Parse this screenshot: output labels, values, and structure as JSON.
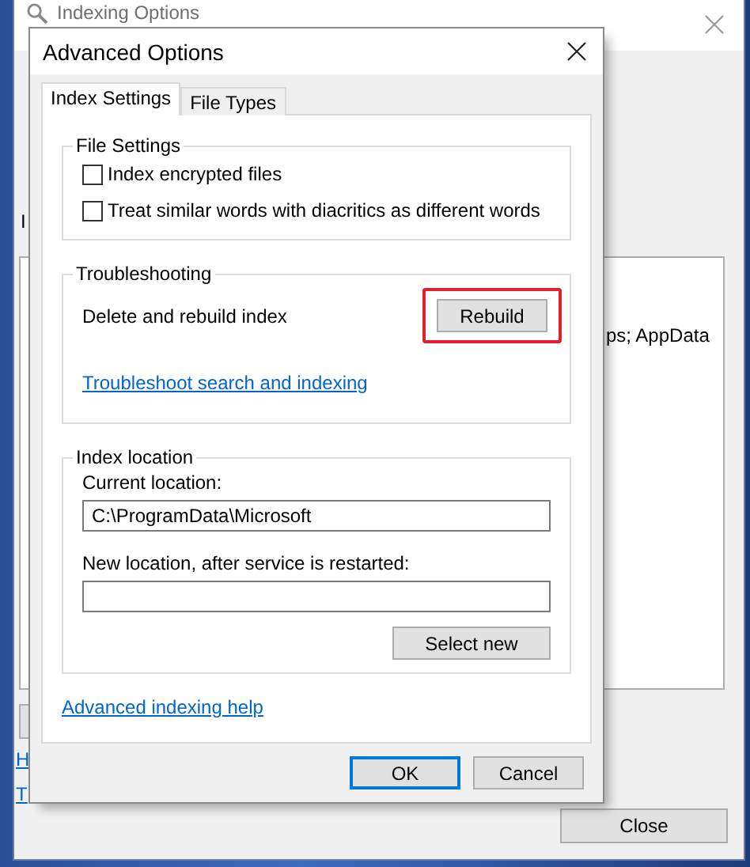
{
  "background_window": {
    "title": "Indexing Options",
    "label": "I",
    "list_text": "ps; AppData",
    "links": [
      "H",
      "T"
    ],
    "close_button": "Close"
  },
  "dialog": {
    "title": "Advanced Options",
    "tabs": [
      {
        "label": "Index Settings",
        "selected": true
      },
      {
        "label": "File Types",
        "selected": false
      }
    ],
    "file_settings": {
      "title": "File Settings",
      "options": [
        {
          "label": "Index encrypted files",
          "checked": false
        },
        {
          "label": "Treat similar words with diacritics as different words",
          "checked": false
        }
      ]
    },
    "troubleshooting": {
      "title": "Troubleshooting",
      "text": "Delete and rebuild index",
      "button": "Rebuild",
      "highlighted": true,
      "link": "Troubleshoot search and indexing"
    },
    "index_location": {
      "title": "Index location",
      "current_label": "Current location:",
      "current_value": "C:\\ProgramData\\Microsoft",
      "new_label": "New location, after service is restarted:",
      "button": "Select new"
    },
    "help_link": "Advanced indexing help",
    "buttons": [
      {
        "label": "OK",
        "default": true
      },
      {
        "label": "Cancel",
        "default": false
      }
    ]
  }
}
